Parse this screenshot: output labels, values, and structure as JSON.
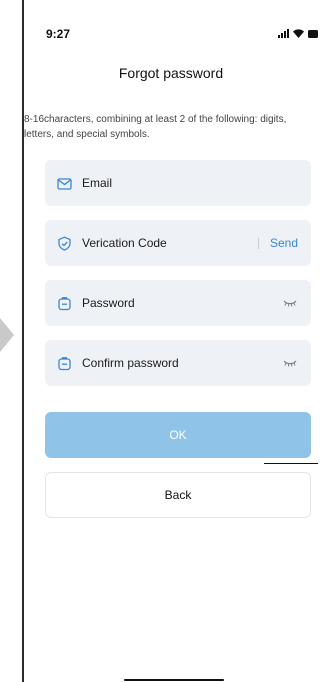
{
  "status_bar": {
    "time": "9:27"
  },
  "header": {
    "title": "Forgot password"
  },
  "hint": {
    "text": "8-16characters, combining at least 2 of the following: digits, letters, and special symbols."
  },
  "form": {
    "email": {
      "placeholder": "Email",
      "icon": "mail-icon"
    },
    "verification": {
      "placeholder": "Verication Code",
      "icon": "shield-check-icon",
      "send_label": "Send"
    },
    "password": {
      "placeholder": "Password",
      "icon": "lock-icon",
      "toggle_icon": "eye-closed-icon"
    },
    "confirm_password": {
      "placeholder": "Confirm password",
      "icon": "lock-icon",
      "toggle_icon": "eye-closed-icon"
    }
  },
  "actions": {
    "ok_label": "OK",
    "back_label": "Back"
  },
  "colors": {
    "accent": "#3a86d6",
    "primary_button": "#8fc4e8",
    "field_background": "#eef1f6"
  }
}
